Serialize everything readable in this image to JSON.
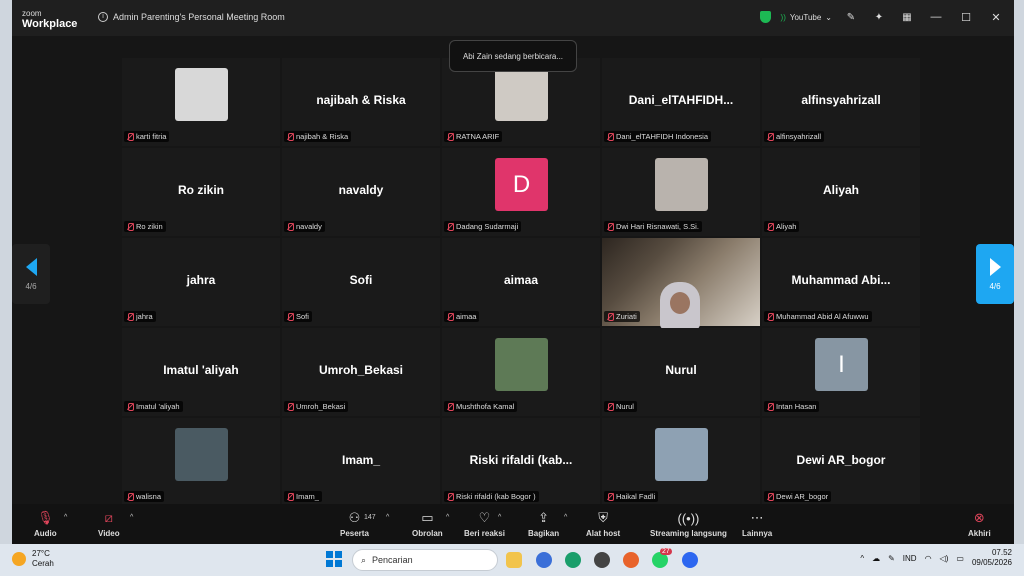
{
  "window": {
    "brand_small": "zoom",
    "brand": "Workplace",
    "title": "Admin Parenting's Personal Meeting Room",
    "share_label": "YouTube"
  },
  "toast": "Abi Zain sedang berbicara...",
  "nav": {
    "left_page": "4/6",
    "right_page": "4/6"
  },
  "tiles": [
    {
      "label": "karti fitria",
      "name": "",
      "kind": "photo",
      "color": "#d8d8d8"
    },
    {
      "label": "najibah & Riska",
      "name": "najibah & Riska",
      "kind": "name"
    },
    {
      "label": "RATNA ARIF",
      "name": "",
      "kind": "photo",
      "color": "#cfcac4"
    },
    {
      "label": "Dani_elTAHFIDH Indonesia",
      "name": "Dani_elTAHFIDH...",
      "kind": "name"
    },
    {
      "label": "alfinsyahrizall",
      "name": "alfinsyahrizall",
      "kind": "name"
    },
    {
      "label": "Ro zikin",
      "name": "Ro zikin",
      "kind": "name"
    },
    {
      "label": "navaldy",
      "name": "navaldy",
      "kind": "name"
    },
    {
      "label": "Dadang Sudarmaji",
      "name": "",
      "kind": "initial",
      "initial": "D",
      "color": "#e0356b"
    },
    {
      "label": "Dwi Hari Risnawati, S.Si.",
      "name": "",
      "kind": "photo",
      "color": "#b9b3ad"
    },
    {
      "label": "Aliyah",
      "name": "Aliyah",
      "kind": "name"
    },
    {
      "label": "jahra",
      "name": "jahra",
      "kind": "name"
    },
    {
      "label": "Sofi",
      "name": "Sofi",
      "kind": "name"
    },
    {
      "label": "aimaa",
      "name": "aimaa",
      "kind": "name"
    },
    {
      "label": "Zuriati",
      "name": "",
      "kind": "video"
    },
    {
      "label": "Muhammad Abid Al Afuwwu",
      "name": "Muhammad  Abi...",
      "kind": "name"
    },
    {
      "label": "Imatul 'aliyah",
      "name": "Imatul 'aliyah",
      "kind": "name"
    },
    {
      "label": "Umroh_Bekasi",
      "name": "Umroh_Bekasi",
      "kind": "name"
    },
    {
      "label": "Mushthofa Kamal",
      "name": "",
      "kind": "photo",
      "color": "#5e7a56"
    },
    {
      "label": "Nurul",
      "name": "Nurul",
      "kind": "name"
    },
    {
      "label": "Intan Hasan",
      "name": "",
      "kind": "initial",
      "initial": "I",
      "color": "#8796a3"
    },
    {
      "label": "walisna",
      "name": "",
      "kind": "photo",
      "color": "#4a5a62"
    },
    {
      "label": "Imam_",
      "name": "Imam_",
      "kind": "name"
    },
    {
      "label": "Riski rifaldi (kab Bogor )",
      "name": "Riski  rifaldi  (kab...",
      "kind": "name"
    },
    {
      "label": "Haikal Fadli",
      "name": "",
      "kind": "photo",
      "color": "#8ea1b3"
    },
    {
      "label": "Dewi AR_bogor",
      "name": "Dewi AR_bogor",
      "kind": "name"
    }
  ],
  "toolbar": {
    "audio": "Audio",
    "video": "Video",
    "participants": "Peserta",
    "participants_count": "147",
    "chat": "Obrolan",
    "react": "Beri reaksi",
    "share": "Bagikan",
    "host": "Alat host",
    "stream": "Streaming langsung",
    "more": "Lainnya",
    "end": "Akhiri"
  },
  "taskbar": {
    "temp": "27°C",
    "weather": "Cerah",
    "search": "Pencarian",
    "lang": "IND",
    "time": "07.52",
    "date": "09/05/2026",
    "badge": "27"
  }
}
